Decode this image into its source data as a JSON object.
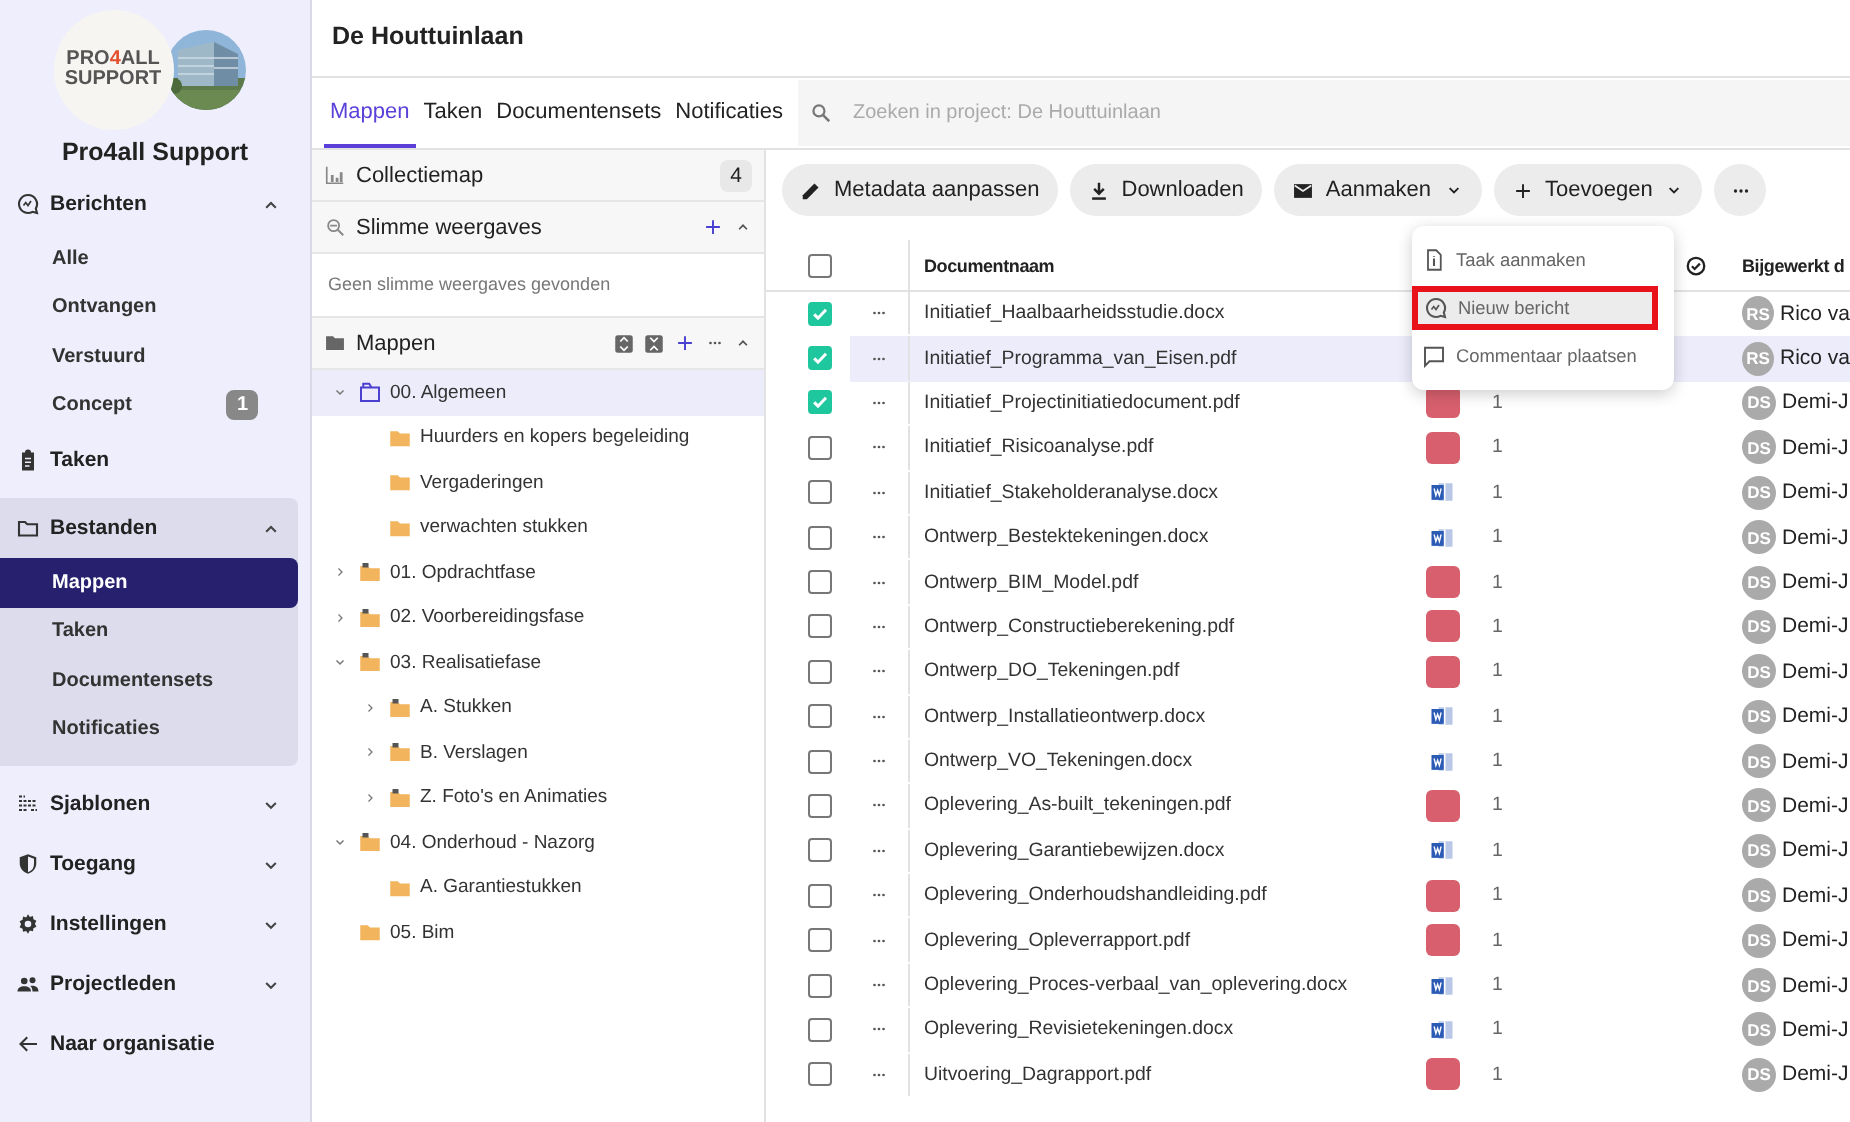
{
  "logo": {
    "parts": [
      "PRO",
      "4",
      "ALL"
    ],
    "line2": "SUPPORT",
    "kind": "picture"
  },
  "org_name": "Pro4all Support",
  "sidebar": {
    "items": [
      {
        "label": "Berichten",
        "expanded": true,
        "children": [
          {
            "label": "Alle",
            "selected": false
          },
          {
            "label": "Ontvangen",
            "selected": false
          },
          {
            "label": "Verstuurd",
            "selected": false
          },
          {
            "label": "Concept",
            "selected": false,
            "badge": "1"
          }
        ]
      },
      {
        "label": "Taken"
      },
      {
        "label": "Bestanden",
        "expanded": true,
        "children": [
          {
            "label": "Mappen",
            "selected": true
          },
          {
            "label": "Taken",
            "selected": false
          },
          {
            "label": "Documentensets",
            "selected": false
          },
          {
            "label": "Notificaties",
            "selected": false
          }
        ]
      },
      {
        "label": "Sjablonen",
        "expanded": false
      },
      {
        "label": "Toegang",
        "expanded": false
      },
      {
        "label": "Instellingen",
        "expanded": false
      },
      {
        "label": "Projectleden",
        "expanded": false
      },
      {
        "label": "Naar organisatie"
      }
    ]
  },
  "project_title": "De Houttuinlaan",
  "tabs": [
    {
      "label": "Mappen",
      "selected": true
    },
    {
      "label": "Taken",
      "selected": false
    },
    {
      "label": "Documentensets",
      "selected": false
    },
    {
      "label": "Notificaties",
      "selected": false
    }
  ],
  "search": {
    "placeholder": "Zoeken in project: De Houttuinlaan"
  },
  "folder_panel": {
    "collection": {
      "label": "Collectiemap",
      "count": "4"
    },
    "smart_views": {
      "label": "Slimme weergaves",
      "expanded": true,
      "empty_text": "Geen slimme weergaves gevonden"
    },
    "folders": {
      "label": "Mappen",
      "expanded": true,
      "tree": [
        {
          "label": "00. Algemeen",
          "kind": "open",
          "expanded": true,
          "selected": true,
          "children": [
            {
              "label": "Huurders en kopers begeleiding",
              "kind": "plain",
              "selected": false
            },
            {
              "label": "Vergaderingen",
              "kind": "plain",
              "selected": false
            },
            {
              "label": "verwachten stukken",
              "kind": "plain",
              "selected": false
            }
          ]
        },
        {
          "label": "01. Opdrachtfase",
          "kind": "parent",
          "expanded": false,
          "selected": false
        },
        {
          "label": "02. Voorbereidingsfase",
          "kind": "parent",
          "expanded": false,
          "selected": false
        },
        {
          "label": "03. Realisatiefase",
          "kind": "parent",
          "expanded": true,
          "selected": false,
          "children": [
            {
              "label": "A. Stukken",
              "kind": "parent",
              "expanded": false,
              "selected": false
            },
            {
              "label": "B. Verslagen",
              "kind": "parent",
              "expanded": false,
              "selected": false
            },
            {
              "label": "Z. Foto's en Animaties",
              "kind": "parent",
              "expanded": false,
              "selected": false
            }
          ]
        },
        {
          "label": "04. Onderhoud - Nazorg",
          "kind": "parent",
          "expanded": true,
          "selected": false,
          "children": [
            {
              "label": "A. Garantiestukken",
              "kind": "plain",
              "selected": false
            }
          ]
        },
        {
          "label": "05. Bim",
          "kind": "plain",
          "selected": false
        }
      ]
    }
  },
  "toolbar": [
    {
      "label": "Metadata aanpassen",
      "dropdown": false
    },
    {
      "label": "Downloaden",
      "dropdown": false
    },
    {
      "label": "Aanmaken",
      "dropdown": true
    },
    {
      "label": "Toevoegen",
      "dropdown": true
    },
    {
      "dropdown": false
    }
  ],
  "menu": {
    "items": [
      {
        "label": "Taak aanmaken",
        "highlighted": false
      },
      {
        "label": "Nieuw bericht",
        "highlighted": true
      },
      {
        "label": "Commentaar plaatsen",
        "highlighted": false
      }
    ]
  },
  "table": {
    "columns": {
      "name": "Documentnaam",
      "column_6": "Bijgewerkt d"
    },
    "header_checked": false,
    "rows": [
      {
        "checked": true,
        "selected": false,
        "name": "Initiatief_Haalbaarheidsstudie.docx",
        "initials": "RS",
        "user": "Rico va"
      },
      {
        "checked": true,
        "selected": true,
        "name": "Initiatief_Programma_van_Eisen.pdf",
        "initials": "RS",
        "user": "Rico va"
      },
      {
        "checked": true,
        "selected": false,
        "name": "Initiatief_Projectinitiatiedocument.pdf",
        "kind": "pdf",
        "version": "1",
        "initials": "DS",
        "user": "Demi-J"
      },
      {
        "checked": false,
        "selected": false,
        "name": "Initiatief_Risicoanalyse.pdf",
        "kind": "pdf",
        "version": "1",
        "initials": "DS",
        "user": "Demi-J"
      },
      {
        "checked": false,
        "selected": false,
        "name": "Initiatief_Stakeholderanalyse.docx",
        "kind": "docx",
        "version": "1",
        "initials": "DS",
        "user": "Demi-J"
      },
      {
        "checked": false,
        "selected": false,
        "name": "Ontwerp_Bestektekeningen.docx",
        "kind": "docx",
        "version": "1",
        "initials": "DS",
        "user": "Demi-J"
      },
      {
        "checked": false,
        "selected": false,
        "name": "Ontwerp_BIM_Model.pdf",
        "kind": "pdf",
        "version": "1",
        "initials": "DS",
        "user": "Demi-J"
      },
      {
        "checked": false,
        "selected": false,
        "name": "Ontwerp_Constructieberekening.pdf",
        "kind": "pdf",
        "version": "1",
        "initials": "DS",
        "user": "Demi-J"
      },
      {
        "checked": false,
        "selected": false,
        "name": "Ontwerp_DO_Tekeningen.pdf",
        "kind": "pdf",
        "version": "1",
        "initials": "DS",
        "user": "Demi-J"
      },
      {
        "checked": false,
        "selected": false,
        "name": "Ontwerp_Installatieontwerp.docx",
        "kind": "docx",
        "version": "1",
        "initials": "DS",
        "user": "Demi-J"
      },
      {
        "checked": false,
        "selected": false,
        "name": "Ontwerp_VO_Tekeningen.docx",
        "kind": "docx",
        "version": "1",
        "initials": "DS",
        "user": "Demi-J"
      },
      {
        "checked": false,
        "selected": false,
        "name": "Oplevering_As-built_tekeningen.pdf",
        "kind": "pdf",
        "version": "1",
        "initials": "DS",
        "user": "Demi-J"
      },
      {
        "checked": false,
        "selected": false,
        "name": "Oplevering_Garantiebewijzen.docx",
        "kind": "docx",
        "version": "1",
        "initials": "DS",
        "user": "Demi-J"
      },
      {
        "checked": false,
        "selected": false,
        "name": "Oplevering_Onderhoudshandleiding.pdf",
        "kind": "pdf",
        "version": "1",
        "initials": "DS",
        "user": "Demi-J"
      },
      {
        "checked": false,
        "selected": false,
        "name": "Oplevering_Opleverrapport.pdf",
        "kind": "pdf",
        "version": "1",
        "initials": "DS",
        "user": "Demi-J"
      },
      {
        "checked": false,
        "selected": false,
        "name": "Oplevering_Proces-verbaal_van_oplevering.docx",
        "kind": "docx",
        "version": "1",
        "initials": "DS",
        "user": "Demi-J"
      },
      {
        "checked": false,
        "selected": false,
        "name": "Oplevering_Revisietekeningen.docx",
        "kind": "docx",
        "version": "1",
        "initials": "DS",
        "user": "Demi-J"
      },
      {
        "checked": false,
        "selected": false,
        "name": "Uitvoering_Dagrapport.pdf",
        "kind": "pdf",
        "version": "1",
        "initials": "DS",
        "user": "Demi-J"
      }
    ]
  }
}
